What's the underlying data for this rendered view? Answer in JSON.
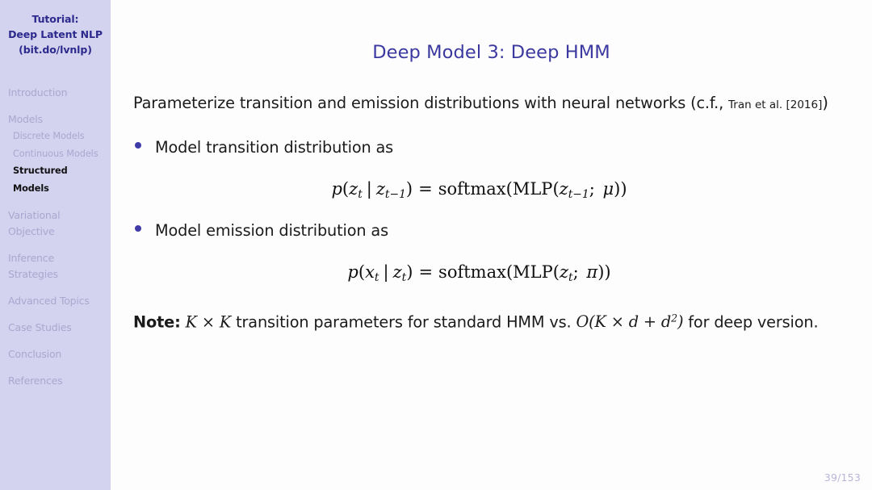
{
  "sidebar": {
    "title_lines": [
      "Tutorial:",
      "Deep Latent NLP",
      "(bit.do/lvnlp)"
    ],
    "sections": [
      {
        "label": "Introduction",
        "active": false,
        "subitems": []
      },
      {
        "label": "Models",
        "active": false,
        "subitems": [
          {
            "label": "Discrete Models",
            "active": false
          },
          {
            "label": "Continuous Models",
            "active": false
          },
          {
            "label": "Structured Models",
            "active": true
          }
        ]
      },
      {
        "label": "Variational Objective",
        "active": false,
        "subitems": []
      },
      {
        "label": "Inference Strategies",
        "active": false,
        "subitems": []
      },
      {
        "label": "Advanced Topics",
        "active": false,
        "subitems": []
      },
      {
        "label": "Case Studies",
        "active": false,
        "subitems": []
      },
      {
        "label": "Conclusion",
        "active": false,
        "subitems": []
      },
      {
        "label": "References",
        "active": false,
        "subitems": []
      }
    ]
  },
  "slide": {
    "title": "Deep Model 3:  Deep HMM",
    "intro": {
      "main_text": "Parameterize transition and emission distributions with neural networks (c.f., ",
      "citation": "Tran et al. [2016]",
      "closing_paren": ")"
    },
    "bullets": [
      {
        "text": "Model transition distribution as",
        "equation_latex": "p(z_t \\mid z_{t-1}) = \\mathrm{softmax}(\\mathrm{MLP}(z_{t-1};\\ \\mu))",
        "equation_parts": {
          "lhs_fn": "p",
          "lhs_var": "z",
          "lhs_sub": "t",
          "cond_var": "z",
          "cond_sub": "t−1",
          "rel": "=",
          "outer_fn": "softmax",
          "inner_fn": "MLP",
          "inner_var": "z",
          "inner_sub": "t−1",
          "param": "μ"
        }
      },
      {
        "text": "Model emission distribution as",
        "equation_latex": "p(x_t \\mid z_t) = \\mathrm{softmax}(\\mathrm{MLP}(z_t;\\ \\pi))",
        "equation_parts": {
          "lhs_fn": "p",
          "lhs_var": "x",
          "lhs_sub": "t",
          "cond_var": "z",
          "cond_sub": "t",
          "rel": "=",
          "outer_fn": "softmax",
          "inner_fn": "MLP",
          "inner_var": "z",
          "inner_sub": "t",
          "param": "π"
        }
      }
    ],
    "note": {
      "label": "Note:",
      "math_1": "K × K",
      "text_1": " transition parameters for standard HMM vs. ",
      "math_2_base": "O(K × d + d",
      "math_2_sup": "2",
      "math_2_close": ")",
      "text_2": " for deep version."
    },
    "page_number": "39/153"
  },
  "colors": {
    "sidebar_bg": "#d3d2ef",
    "sidebar_title": "#2c2a8c",
    "sidebar_inactive": "#aaa8cf",
    "sidebar_active": "#111111",
    "frame_title": "#3b39a0",
    "bullet": "#3f3ca8",
    "body_text": "#1b1b1b",
    "page_number": "#b8b6d8",
    "slide_bg": "#fdfdfd"
  }
}
